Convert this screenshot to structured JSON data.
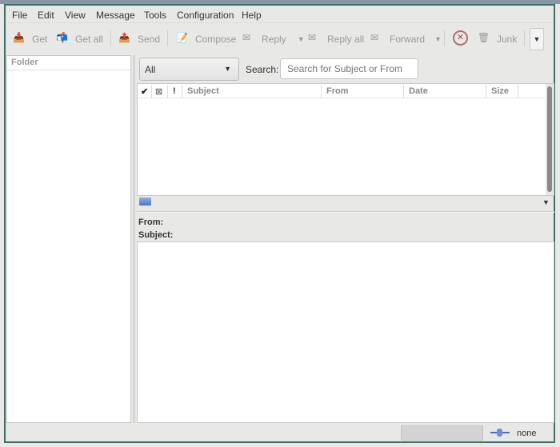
{
  "menu": [
    "File",
    "Edit",
    "View",
    "Message",
    "Tools",
    "Configuration",
    "Help"
  ],
  "toolbar": {
    "get": "Get",
    "get_all": "Get all",
    "send": "Send",
    "compose": "Compose",
    "reply": "Reply",
    "reply_all": "Reply all",
    "forward": "Forward",
    "junk": "Junk"
  },
  "folder_header": "Folder",
  "filter": {
    "selected": "All"
  },
  "search": {
    "label": "Search:",
    "placeholder": "Search for Subject or From"
  },
  "columns": {
    "check": "✔",
    "subject": "Subject",
    "from": "From",
    "date": "Date",
    "size": "Size"
  },
  "preview": {
    "from_label": "From:",
    "subject_label": "Subject:"
  },
  "status": {
    "connection": "none"
  }
}
